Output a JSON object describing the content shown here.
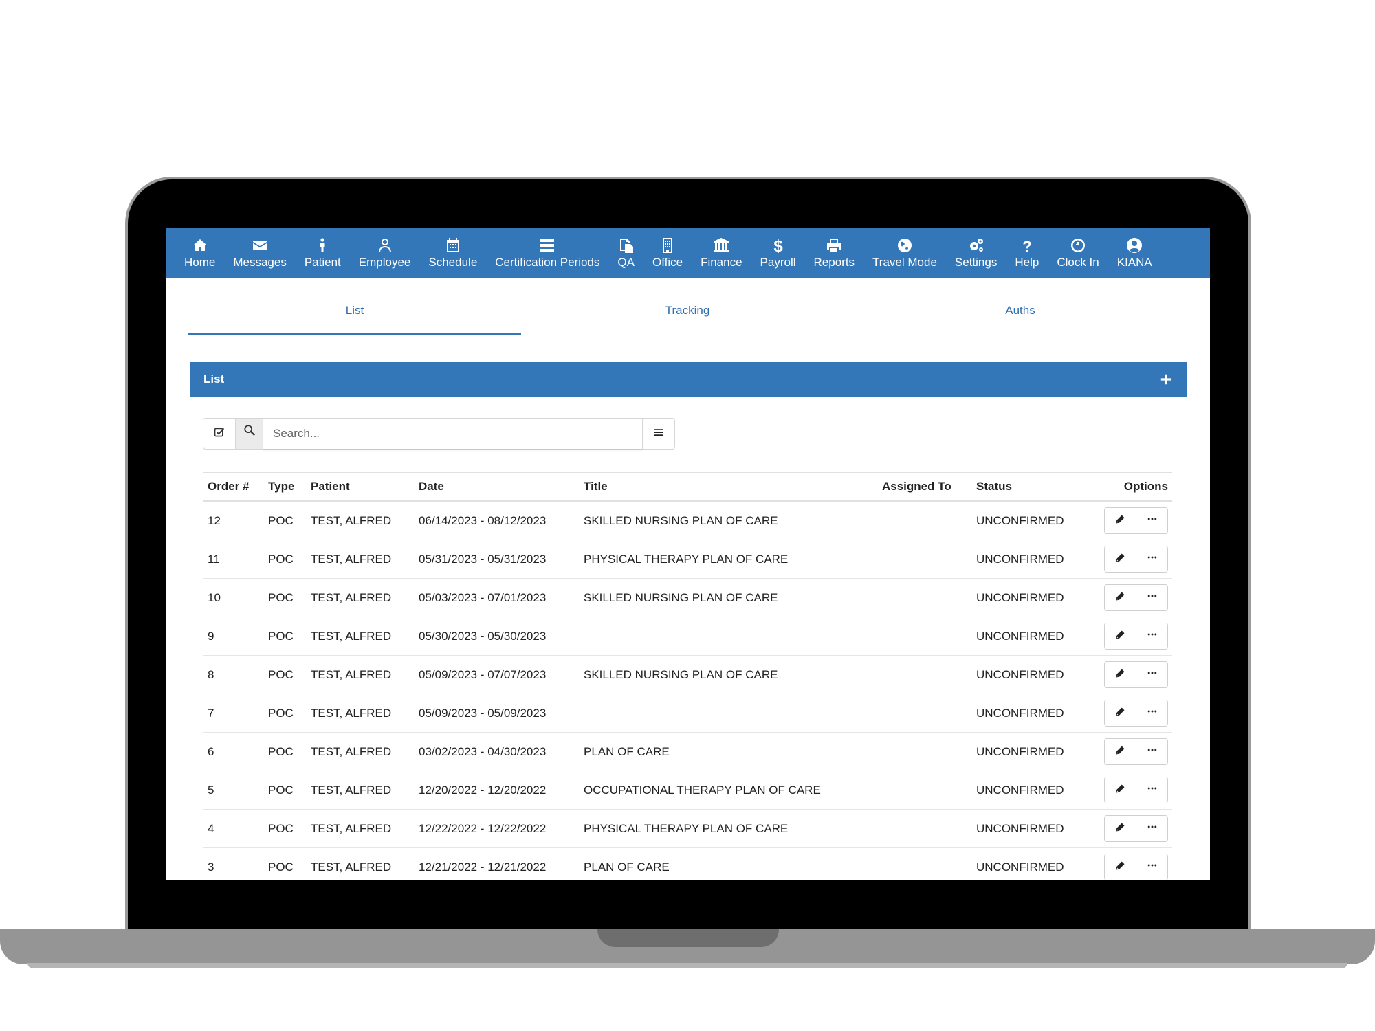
{
  "nav": [
    {
      "label": "Home",
      "icon": "home-icon"
    },
    {
      "label": "Messages",
      "icon": "envelope-icon"
    },
    {
      "label": "Patient",
      "icon": "person-icon"
    },
    {
      "label": "Employee",
      "icon": "user-outline-icon"
    },
    {
      "label": "Schedule",
      "icon": "calendar-icon"
    },
    {
      "label": "Certification Periods",
      "icon": "list-card-icon"
    },
    {
      "label": "QA",
      "icon": "documents-icon"
    },
    {
      "label": "Office",
      "icon": "building-icon"
    },
    {
      "label": "Finance",
      "icon": "bank-icon"
    },
    {
      "label": "Payroll",
      "icon": "dollar-icon"
    },
    {
      "label": "Reports",
      "icon": "printer-icon"
    },
    {
      "label": "Travel Mode",
      "icon": "globe-icon"
    },
    {
      "label": "Settings",
      "icon": "gears-icon"
    },
    {
      "label": "Help",
      "icon": "question-icon"
    },
    {
      "label": "Clock In",
      "icon": "clock-icon"
    },
    {
      "label": "KIANA",
      "icon": "user-circle-icon"
    }
  ],
  "tabs": [
    {
      "label": "List",
      "active": true
    },
    {
      "label": "Tracking",
      "active": false
    },
    {
      "label": "Auths",
      "active": false
    }
  ],
  "panel": {
    "title": "List"
  },
  "search": {
    "placeholder": "Search..."
  },
  "table": {
    "headers": [
      "Order #",
      "Type",
      "Patient",
      "Date",
      "Title",
      "Assigned To",
      "Status",
      "Options"
    ],
    "rows": [
      {
        "order": "12",
        "type": "POC",
        "patient": "TEST, ALFRED",
        "date": "06/14/2023 - 08/12/2023",
        "title": "SKILLED NURSING PLAN OF CARE",
        "assigned": "",
        "status": "UNCONFIRMED"
      },
      {
        "order": "11",
        "type": "POC",
        "patient": "TEST, ALFRED",
        "date": "05/31/2023 - 05/31/2023",
        "title": "PHYSICAL THERAPY PLAN OF CARE",
        "assigned": "",
        "status": "UNCONFIRMED"
      },
      {
        "order": "10",
        "type": "POC",
        "patient": "TEST, ALFRED",
        "date": "05/03/2023 - 07/01/2023",
        "title": "SKILLED NURSING PLAN OF CARE",
        "assigned": "",
        "status": "UNCONFIRMED"
      },
      {
        "order": "9",
        "type": "POC",
        "patient": "TEST, ALFRED",
        "date": "05/30/2023 - 05/30/2023",
        "title": "",
        "assigned": "",
        "status": "UNCONFIRMED"
      },
      {
        "order": "8",
        "type": "POC",
        "patient": "TEST, ALFRED",
        "date": "05/09/2023 - 07/07/2023",
        "title": "SKILLED NURSING PLAN OF CARE",
        "assigned": "",
        "status": "UNCONFIRMED"
      },
      {
        "order": "7",
        "type": "POC",
        "patient": "TEST, ALFRED",
        "date": "05/09/2023 - 05/09/2023",
        "title": "",
        "assigned": "",
        "status": "UNCONFIRMED"
      },
      {
        "order": "6",
        "type": "POC",
        "patient": "TEST, ALFRED",
        "date": "03/02/2023 - 04/30/2023",
        "title": "PLAN OF CARE",
        "assigned": "",
        "status": "UNCONFIRMED"
      },
      {
        "order": "5",
        "type": "POC",
        "patient": "TEST, ALFRED",
        "date": "12/20/2022 - 12/20/2022",
        "title": "OCCUPATIONAL THERAPY PLAN OF CARE",
        "assigned": "",
        "status": "UNCONFIRMED"
      },
      {
        "order": "4",
        "type": "POC",
        "patient": "TEST, ALFRED",
        "date": "12/22/2022 - 12/22/2022",
        "title": "PHYSICAL THERAPY PLAN OF CARE",
        "assigned": "",
        "status": "UNCONFIRMED"
      },
      {
        "order": "3",
        "type": "POC",
        "patient": "TEST, ALFRED",
        "date": "12/21/2022 - 12/21/2022",
        "title": "PLAN OF CARE",
        "assigned": "",
        "status": "UNCONFIRMED"
      }
    ]
  },
  "colors": {
    "primary": "#3377b8",
    "tab_text": "#2f6faf"
  }
}
